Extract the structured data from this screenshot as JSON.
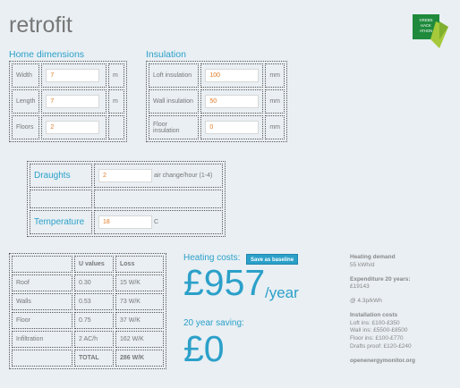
{
  "app": {
    "title": "retrofit",
    "logo_lines": [
      "GREEN",
      "HACK",
      "ATHON"
    ]
  },
  "home_dimensions": {
    "title": "Home dimensions",
    "rows": [
      {
        "label": "Width",
        "value": "7",
        "unit": "m"
      },
      {
        "label": "Length",
        "value": "7",
        "unit": "m"
      },
      {
        "label": "Floors",
        "value": "2",
        "unit": ""
      }
    ]
  },
  "insulation": {
    "title": "Insulation",
    "rows": [
      {
        "label": "Loft insulation",
        "value": "100",
        "unit": "mm"
      },
      {
        "label": "Wall insulation",
        "value": "50",
        "unit": "mm"
      },
      {
        "label": "Floor insulation",
        "value": "0",
        "unit": "mm"
      }
    ]
  },
  "draughts": {
    "label": "Draughts",
    "value": "2",
    "unit": "air change/hour (1-4)"
  },
  "temperature": {
    "label": "Temperature",
    "value": "18",
    "unit": "C"
  },
  "uvalues": {
    "headers": [
      "",
      "U values",
      "Loss"
    ],
    "rows": [
      {
        "name": "Roof",
        "u": "0.30",
        "loss": "15 W/K"
      },
      {
        "name": "Walls",
        "u": "0.53",
        "loss": "73 W/K"
      },
      {
        "name": "Floor",
        "u": "0.75",
        "loss": "37 W/K"
      },
      {
        "name": "Infiltration",
        "u": "2 AC/h",
        "loss": "162 W/K"
      }
    ],
    "total_label": "TOTAL",
    "total_value": "286 W/K"
  },
  "costs": {
    "heating_label": "Heating costs:",
    "save_button": "Save as baseline",
    "amount": "£957",
    "per": "/year",
    "saving_label": "20 year saving:",
    "saving_amount": "£0"
  },
  "summary": {
    "demand_title": "Heating demand",
    "demand_value": "55 kWh/d",
    "expenditure_title": "Expenditure 20 years:",
    "expenditure_value": "£19143",
    "rate": "@ 4.3p/kWh",
    "install_title": "Installation costs",
    "install_lines": [
      "Loft ins: £100-£350",
      "Wall ins: £5500-£8500",
      "Floor ins: £100-£770",
      "Drafts proof: £120-£240"
    ],
    "footer": "openenergymonitor.org"
  },
  "colors": {
    "accent": "#2ba0c9",
    "value_text": "#e07a26",
    "logo_green": "#1f8a3c",
    "logo_lime": "#a5c93a"
  }
}
